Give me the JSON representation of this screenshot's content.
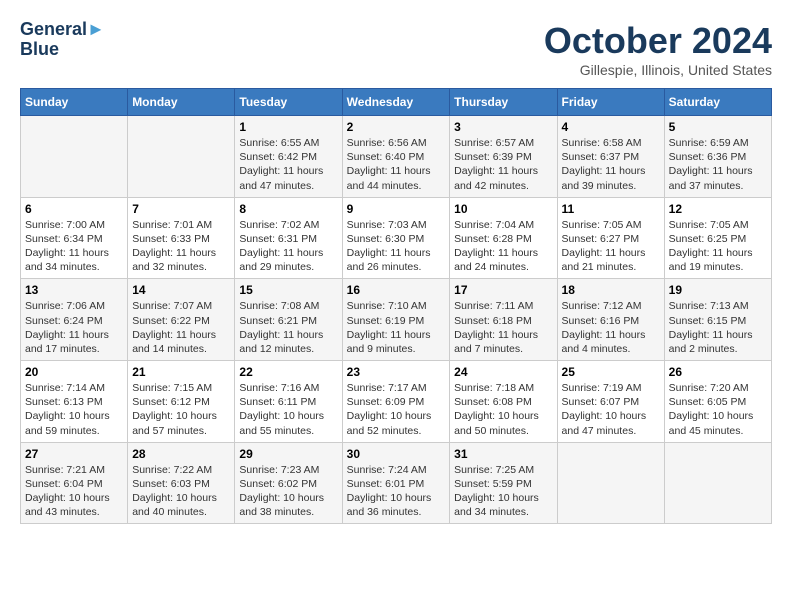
{
  "header": {
    "logo_line1": "General",
    "logo_line2": "Blue",
    "month": "October 2024",
    "location": "Gillespie, Illinois, United States"
  },
  "days_of_week": [
    "Sunday",
    "Monday",
    "Tuesday",
    "Wednesday",
    "Thursday",
    "Friday",
    "Saturday"
  ],
  "weeks": [
    [
      {
        "day": "",
        "info": ""
      },
      {
        "day": "",
        "info": ""
      },
      {
        "day": "1",
        "info": "Sunrise: 6:55 AM\nSunset: 6:42 PM\nDaylight: 11 hours and 47 minutes."
      },
      {
        "day": "2",
        "info": "Sunrise: 6:56 AM\nSunset: 6:40 PM\nDaylight: 11 hours and 44 minutes."
      },
      {
        "day": "3",
        "info": "Sunrise: 6:57 AM\nSunset: 6:39 PM\nDaylight: 11 hours and 42 minutes."
      },
      {
        "day": "4",
        "info": "Sunrise: 6:58 AM\nSunset: 6:37 PM\nDaylight: 11 hours and 39 minutes."
      },
      {
        "day": "5",
        "info": "Sunrise: 6:59 AM\nSunset: 6:36 PM\nDaylight: 11 hours and 37 minutes."
      }
    ],
    [
      {
        "day": "6",
        "info": "Sunrise: 7:00 AM\nSunset: 6:34 PM\nDaylight: 11 hours and 34 minutes."
      },
      {
        "day": "7",
        "info": "Sunrise: 7:01 AM\nSunset: 6:33 PM\nDaylight: 11 hours and 32 minutes."
      },
      {
        "day": "8",
        "info": "Sunrise: 7:02 AM\nSunset: 6:31 PM\nDaylight: 11 hours and 29 minutes."
      },
      {
        "day": "9",
        "info": "Sunrise: 7:03 AM\nSunset: 6:30 PM\nDaylight: 11 hours and 26 minutes."
      },
      {
        "day": "10",
        "info": "Sunrise: 7:04 AM\nSunset: 6:28 PM\nDaylight: 11 hours and 24 minutes."
      },
      {
        "day": "11",
        "info": "Sunrise: 7:05 AM\nSunset: 6:27 PM\nDaylight: 11 hours and 21 minutes."
      },
      {
        "day": "12",
        "info": "Sunrise: 7:05 AM\nSunset: 6:25 PM\nDaylight: 11 hours and 19 minutes."
      }
    ],
    [
      {
        "day": "13",
        "info": "Sunrise: 7:06 AM\nSunset: 6:24 PM\nDaylight: 11 hours and 17 minutes."
      },
      {
        "day": "14",
        "info": "Sunrise: 7:07 AM\nSunset: 6:22 PM\nDaylight: 11 hours and 14 minutes."
      },
      {
        "day": "15",
        "info": "Sunrise: 7:08 AM\nSunset: 6:21 PM\nDaylight: 11 hours and 12 minutes."
      },
      {
        "day": "16",
        "info": "Sunrise: 7:10 AM\nSunset: 6:19 PM\nDaylight: 11 hours and 9 minutes."
      },
      {
        "day": "17",
        "info": "Sunrise: 7:11 AM\nSunset: 6:18 PM\nDaylight: 11 hours and 7 minutes."
      },
      {
        "day": "18",
        "info": "Sunrise: 7:12 AM\nSunset: 6:16 PM\nDaylight: 11 hours and 4 minutes."
      },
      {
        "day": "19",
        "info": "Sunrise: 7:13 AM\nSunset: 6:15 PM\nDaylight: 11 hours and 2 minutes."
      }
    ],
    [
      {
        "day": "20",
        "info": "Sunrise: 7:14 AM\nSunset: 6:13 PM\nDaylight: 10 hours and 59 minutes."
      },
      {
        "day": "21",
        "info": "Sunrise: 7:15 AM\nSunset: 6:12 PM\nDaylight: 10 hours and 57 minutes."
      },
      {
        "day": "22",
        "info": "Sunrise: 7:16 AM\nSunset: 6:11 PM\nDaylight: 10 hours and 55 minutes."
      },
      {
        "day": "23",
        "info": "Sunrise: 7:17 AM\nSunset: 6:09 PM\nDaylight: 10 hours and 52 minutes."
      },
      {
        "day": "24",
        "info": "Sunrise: 7:18 AM\nSunset: 6:08 PM\nDaylight: 10 hours and 50 minutes."
      },
      {
        "day": "25",
        "info": "Sunrise: 7:19 AM\nSunset: 6:07 PM\nDaylight: 10 hours and 47 minutes."
      },
      {
        "day": "26",
        "info": "Sunrise: 7:20 AM\nSunset: 6:05 PM\nDaylight: 10 hours and 45 minutes."
      }
    ],
    [
      {
        "day": "27",
        "info": "Sunrise: 7:21 AM\nSunset: 6:04 PM\nDaylight: 10 hours and 43 minutes."
      },
      {
        "day": "28",
        "info": "Sunrise: 7:22 AM\nSunset: 6:03 PM\nDaylight: 10 hours and 40 minutes."
      },
      {
        "day": "29",
        "info": "Sunrise: 7:23 AM\nSunset: 6:02 PM\nDaylight: 10 hours and 38 minutes."
      },
      {
        "day": "30",
        "info": "Sunrise: 7:24 AM\nSunset: 6:01 PM\nDaylight: 10 hours and 36 minutes."
      },
      {
        "day": "31",
        "info": "Sunrise: 7:25 AM\nSunset: 5:59 PM\nDaylight: 10 hours and 34 minutes."
      },
      {
        "day": "",
        "info": ""
      },
      {
        "day": "",
        "info": ""
      }
    ]
  ]
}
